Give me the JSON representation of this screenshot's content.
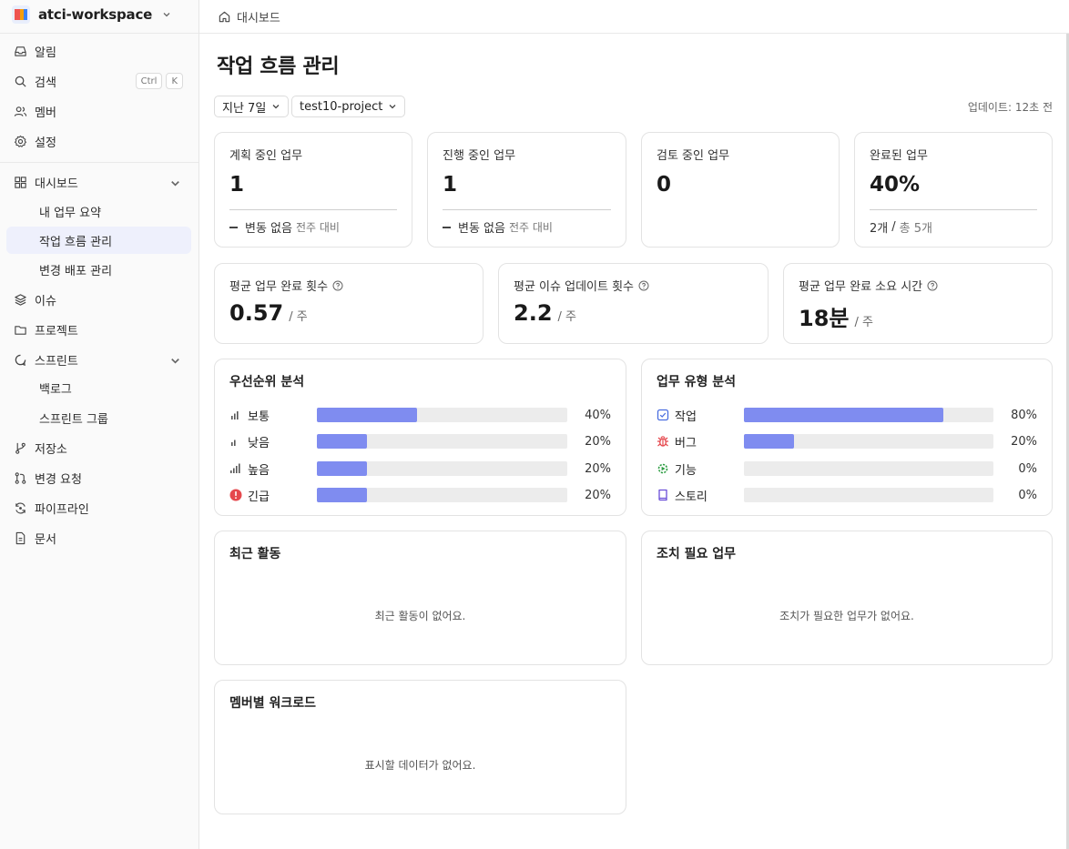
{
  "workspace": {
    "name": "atci-workspace"
  },
  "sidebar": {
    "top_items": [
      {
        "label": "알림"
      },
      {
        "label": "검색",
        "shortcut": [
          "Ctrl",
          "K"
        ]
      },
      {
        "label": "멤버"
      },
      {
        "label": "설정"
      }
    ],
    "dashboard": {
      "label": "대시보드",
      "children": [
        "내 업무 요약",
        "작업 흐름 관리",
        "변경 배포 관리"
      ],
      "active": "작업 흐름 관리"
    },
    "issues": {
      "label": "이슈"
    },
    "projects": {
      "label": "프로젝트"
    },
    "sprints": {
      "label": "스프린트",
      "children": [
        "백로그",
        "스프린트 그룹"
      ]
    },
    "bottom_items": [
      {
        "label": "저장소"
      },
      {
        "label": "변경 요청"
      },
      {
        "label": "파이프라인"
      },
      {
        "label": "문서"
      }
    ]
  },
  "breadcrumb": {
    "label": "대시보드"
  },
  "page": {
    "title": "작업 흐름 관리",
    "filters": {
      "period": "지난 7일",
      "project": "test10-project"
    },
    "updated": "업데이트: 12초 전"
  },
  "stats": [
    {
      "label": "계획 중인 업무",
      "value": "1",
      "change": "변동 없음",
      "compare": "전주 대비"
    },
    {
      "label": "진행 중인 업무",
      "value": "1",
      "change": "변동 없음",
      "compare": "전주 대비"
    },
    {
      "label": "검토 중인 업무",
      "value": "0"
    },
    {
      "label": "완료된 업무",
      "value": "40%",
      "done": "2개",
      "sep": "/",
      "total": "총 5개"
    }
  ],
  "metrics": [
    {
      "label": "평균 업무 완료 횟수",
      "value": "0.57",
      "unit": "/ 주"
    },
    {
      "label": "평균 이슈 업데이트 횟수",
      "value": "2.2",
      "unit": "/ 주"
    },
    {
      "label": "평균 업무 완료 소요 시간",
      "value": "18분",
      "unit": "/ 주"
    }
  ],
  "priority": {
    "title": "우선순위 분석",
    "rows": [
      {
        "label": "보통",
        "icon": "signal-medium-icon",
        "percent": 40,
        "text": "40%"
      },
      {
        "label": "낮음",
        "icon": "signal-low-icon",
        "percent": 20,
        "text": "20%"
      },
      {
        "label": "높음",
        "icon": "signal-high-icon",
        "percent": 20,
        "text": "20%"
      },
      {
        "label": "긴급",
        "icon": "urgent-icon",
        "percent": 20,
        "text": "20%"
      }
    ]
  },
  "types": {
    "title": "업무 유형 분석",
    "rows": [
      {
        "label": "작업",
        "icon": "task-icon",
        "percent": 80,
        "text": "80%"
      },
      {
        "label": "버그",
        "icon": "bug-icon",
        "percent": 20,
        "text": "20%"
      },
      {
        "label": "기능",
        "icon": "feature-icon",
        "percent": 0,
        "text": "0%"
      },
      {
        "label": "스토리",
        "icon": "story-icon",
        "percent": 0,
        "text": "0%"
      }
    ]
  },
  "recent": {
    "title": "최근 활동",
    "empty": "최근 활동이 없어요."
  },
  "action": {
    "title": "조치 필요 업무",
    "empty": "조치가 필요한 업무가 없어요."
  },
  "workload": {
    "title": "멤버별 워크로드",
    "empty": "표시할 데이터가 없어요."
  },
  "colors": {
    "accent": "#7f8cf0",
    "track": "#ececec",
    "active_bg": "#eef0fc",
    "urgent": "#e5484d",
    "bug": "#e5484d",
    "feature": "#2f9e44",
    "task": "#4a6ee0",
    "story": "#6b4fd8"
  }
}
